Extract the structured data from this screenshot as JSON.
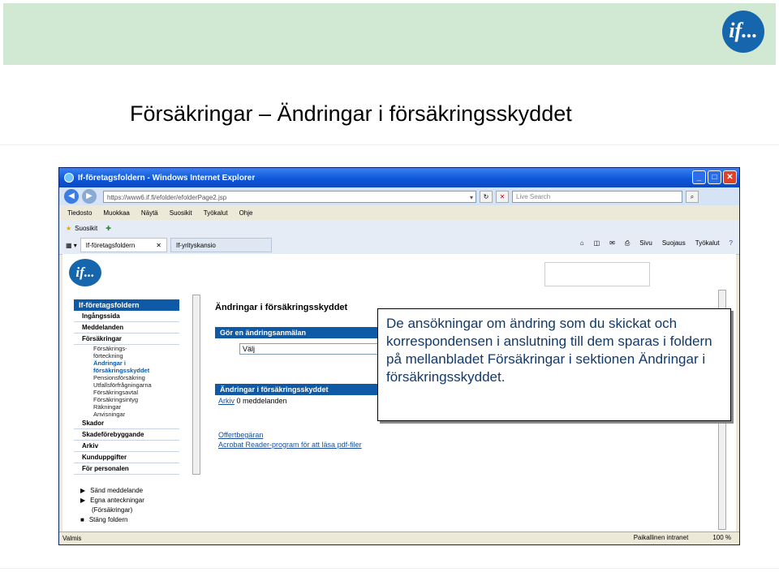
{
  "slide": {
    "title": "Försäkringar – Ändringar i försäkringsskyddet",
    "logo_text": "if..."
  },
  "browser": {
    "window_title": "If-företagsfoldern - Windows Internet Explorer",
    "address": "https://www6.if.fi/efolder/efolderPage2.jsp",
    "search_placeholder": "Live Search",
    "menu": [
      "Tiedosto",
      "Muokkaa",
      "Näytä",
      "Suosikit",
      "Työkalut",
      "Ohje"
    ],
    "favorites_label": "Suosikit",
    "tabs": [
      "If-företagsfoldern",
      "If-yrityskansio"
    ],
    "tools": [
      "Sivu",
      "Suojaus",
      "Työkalut"
    ],
    "status_left": "Valmis",
    "status_zone": "Paikallinen intranet",
    "zoom": "100 %"
  },
  "page": {
    "logo_text": "if...",
    "sidenav": {
      "header": "If-företagsfoldern",
      "items_top": [
        "Ingångssida",
        "Meddelanden",
        "Försäkringar"
      ],
      "sub_items": [
        "Försäkrings-",
        "förteckning",
        "Ändringar i",
        "försäkringsskyddet",
        "Pensionsförsäkring",
        "Utfallsförfrågningarna",
        "Försäkringsavtal",
        "Försäkringsintyg",
        "Räkningar",
        "Anvisningar"
      ],
      "items_bottom": [
        "Skador",
        "Skadeförebyggande",
        "Arkiv",
        "Kunduppgifter",
        "För personalen"
      ]
    },
    "bottom_links": [
      "Sänd meddelande",
      "Egna anteckningar",
      "(Försäkringar)",
      "Stäng foldern"
    ],
    "main_title": "Ändringar i försäkringsskyddet",
    "panel1_header": "Gör en ändringsanmälan",
    "select_value": "Välj",
    "panel2_header": "Ändringar i försäkringsskyddet",
    "archive_link": "Arkiv",
    "messages_count": "0 meddelanden",
    "link1": "Offertbegäran",
    "link2": "Acrobat Reader-program för att läsa pdf-filer"
  },
  "callout": {
    "text": "De ansökningar om ändring som du skickat och korrespondensen i anslutning till dem sparas i foldern på mellanbladet Försäkringar i sektionen Ändringar i försäkringsskyddet."
  },
  "colors": {
    "band": "#d1e8d3",
    "brand_blue": "#1666ad",
    "callout_text": "#103a6e"
  }
}
